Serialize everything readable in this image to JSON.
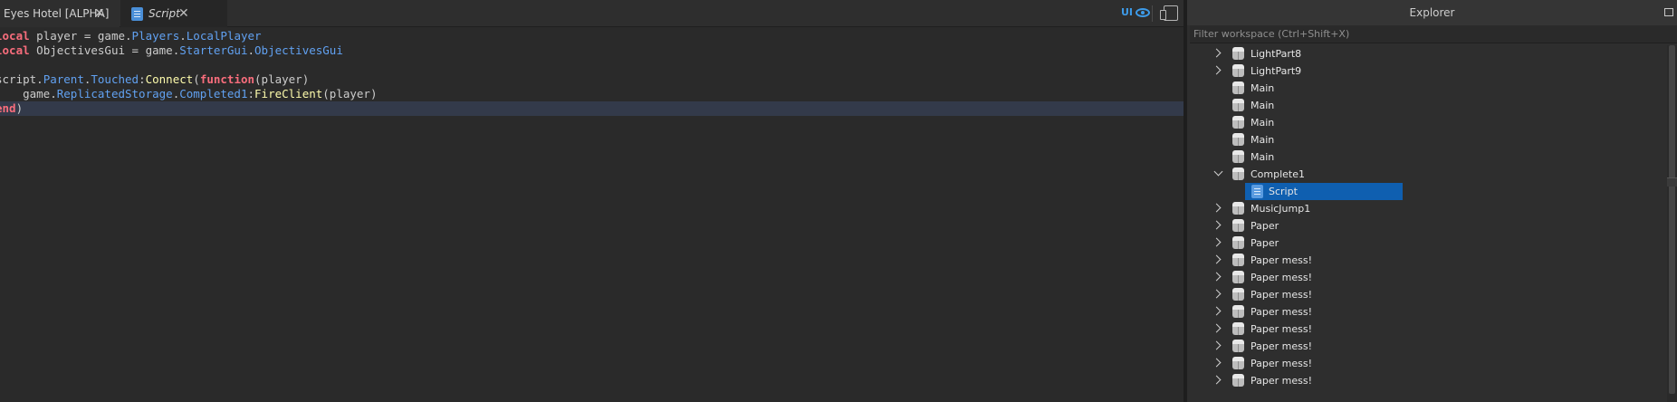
{
  "tabs": [
    {
      "label": "Eyes Hotel [ALPHA]",
      "close": "✕"
    },
    {
      "label": "Script",
      "close": "✕"
    }
  ],
  "toolbar": {
    "ui_label": "UI"
  },
  "code": {
    "lines": [
      [
        [
          "kw",
          "local"
        ],
        [
          "id",
          " player = "
        ],
        [
          "gl",
          "game"
        ],
        [
          "op",
          "."
        ],
        [
          "mem",
          "Players"
        ],
        [
          "op",
          "."
        ],
        [
          "mem",
          "LocalPlayer"
        ]
      ],
      [
        [
          "kw",
          "local"
        ],
        [
          "id",
          " ObjectivesGui = "
        ],
        [
          "gl",
          "game"
        ],
        [
          "op",
          "."
        ],
        [
          "mem",
          "StarterGui"
        ],
        [
          "op",
          "."
        ],
        [
          "mem",
          "ObjectivesGui"
        ]
      ],
      [],
      [
        [
          "gl",
          "script"
        ],
        [
          "op",
          "."
        ],
        [
          "mem",
          "Parent"
        ],
        [
          "op",
          "."
        ],
        [
          "mem",
          "Touched"
        ],
        [
          "op",
          ":"
        ],
        [
          "fn",
          "Connect"
        ],
        [
          "op",
          "("
        ],
        [
          "kw",
          "function"
        ],
        [
          "op",
          "(player)"
        ]
      ],
      [
        [
          "id",
          "    "
        ],
        [
          "gl",
          "game"
        ],
        [
          "op",
          "."
        ],
        [
          "mem",
          "ReplicatedStorage"
        ],
        [
          "op",
          "."
        ],
        [
          "mem",
          "Completed1"
        ],
        [
          "op",
          ":"
        ],
        [
          "fn",
          "FireClient"
        ],
        [
          "op",
          "(player)"
        ]
      ],
      [
        [
          "kw",
          "end"
        ],
        [
          "op",
          ")"
        ]
      ]
    ]
  },
  "explorer": {
    "title": "Explorer",
    "filter_placeholder": "Filter workspace (Ctrl+Shift+X)",
    "items": [
      {
        "label": "LightPart8",
        "expand": "collapsed",
        "icon": "part-icon"
      },
      {
        "label": "LightPart9",
        "expand": "collapsed",
        "icon": "part-icon"
      },
      {
        "label": "Main",
        "expand": "none",
        "icon": "part-icon"
      },
      {
        "label": "Main",
        "expand": "none",
        "icon": "part-icon"
      },
      {
        "label": "Main",
        "expand": "none",
        "icon": "part-icon"
      },
      {
        "label": "Main",
        "expand": "none",
        "icon": "part-icon"
      },
      {
        "label": "Main",
        "expand": "none",
        "icon": "part-icon"
      },
      {
        "label": "Complete1",
        "expand": "expanded",
        "icon": "part-icon"
      },
      {
        "label": "Script",
        "expand": "none",
        "icon": "script-icon",
        "child": true,
        "selected": true
      },
      {
        "label": "MusicJump1",
        "expand": "collapsed",
        "icon": "part-icon"
      },
      {
        "label": "Paper",
        "expand": "collapsed",
        "icon": "part-icon"
      },
      {
        "label": "Paper",
        "expand": "collapsed",
        "icon": "part-icon"
      },
      {
        "label": "Paper mess!",
        "expand": "collapsed",
        "icon": "part-icon"
      },
      {
        "label": "Paper mess!",
        "expand": "collapsed",
        "icon": "part-icon"
      },
      {
        "label": "Paper mess!",
        "expand": "collapsed",
        "icon": "part-icon"
      },
      {
        "label": "Paper mess!",
        "expand": "collapsed",
        "icon": "part-icon"
      },
      {
        "label": "Paper mess!",
        "expand": "collapsed",
        "icon": "part-icon"
      },
      {
        "label": "Paper mess!",
        "expand": "collapsed",
        "icon": "part-icon"
      },
      {
        "label": "Paper mess!",
        "expand": "collapsed",
        "icon": "part-icon"
      },
      {
        "label": "Paper mess!",
        "expand": "collapsed",
        "icon": "part-icon"
      }
    ]
  },
  "colors": {
    "keyword": "#f86d7c",
    "member": "#61a1f1",
    "function": "#fdfbac",
    "selection": "#0f5fb0",
    "accent": "#3d9be9"
  }
}
